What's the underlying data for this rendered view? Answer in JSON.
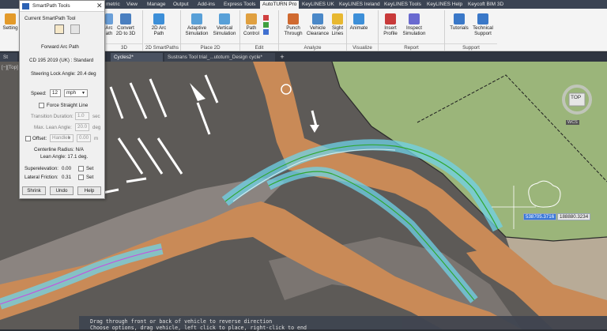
{
  "ribbon": {
    "tabs": [
      "St",
      "metric",
      "View",
      "Manage",
      "Output",
      "Add-ins",
      "Express Tools",
      "AutoTURN Pro",
      "KeyLINES UK",
      "KeyLINES Ireland",
      "KeyLINES Tools",
      "KeyLINES Help",
      "Keycoft BIM 3D"
    ],
    "active_tab": "AutoTURN Pro",
    "buttons": {
      "setting": "Setting",
      "arc_path": [
        "Arc",
        "ath"
      ],
      "convert": [
        "Convert",
        "2D to 3D"
      ],
      "arc2d": [
        "2D Arc",
        "Path"
      ],
      "adaptive": [
        "Adaptive",
        "Simulation"
      ],
      "vertical": [
        "Vertical",
        "Simulation"
      ],
      "path_control": [
        "Path",
        "Control"
      ],
      "punch": [
        "Punch",
        "Through"
      ],
      "vehicle_clear": [
        "Vehicle",
        "Clearance"
      ],
      "sight": [
        "Sight",
        "Lines"
      ],
      "animate": "Animate",
      "insert_profile": [
        "Insert",
        "Profile"
      ],
      "inspect": [
        "Inspect",
        "Simulation"
      ],
      "tutorials": "Tutorials",
      "tech_support": [
        "Technical",
        "Support"
      ]
    },
    "groups": [
      "3D",
      "2D SmartPaths",
      "Place 2D",
      "Edit",
      "Analyze",
      "Visualize",
      "Report",
      "Support"
    ]
  },
  "doc_tabs": [
    "St",
    "Cycles2*",
    "Sustrans Tool trial_...utoturn_Design cycle*"
  ],
  "viewport_label": "[−][Top]",
  "panel": {
    "title": "SmartPath Tools",
    "current_tool_label": "Current SmartPath Tool",
    "path_type": "Forward Arc Path",
    "vehicle": "CD 195 2019 (UK) : Standard",
    "steering": "Steering Lock Angle: 20.4 deg",
    "speed_label": "Speed:",
    "speed_value": "12",
    "speed_unit": "mph",
    "force_straight": "Force Straight Line",
    "transition_label": "Transition Duration:",
    "transition_value": "1.0",
    "transition_unit": "sec",
    "lean_label": "Max. Lean Angle:",
    "lean_value": "20.0",
    "lean_unit": "deg",
    "offset_label": "Offset:",
    "offset_select": "Handleb",
    "offset_value": "0.00",
    "offset_unit": "m",
    "centerline": "Centerline Radius: N/A",
    "lean_angle": "Lean Angle: 17.1 deg.",
    "superelev_label": "Superelevation:",
    "superelev_value": "0.00",
    "lateral_label": "Lateral Friction:",
    "lateral_value": "0.31",
    "set_label": "Set",
    "shrink": "Shrink",
    "undo": "Undo",
    "help": "Help"
  },
  "viewcube": {
    "top_label": "TOP",
    "wcs_label": "WCS"
  },
  "cursor_coords": {
    "x": "538705.3716",
    "y": "188880.3234"
  },
  "command_line": {
    "line1": "Drag through front or back of vehicle to reverse direction",
    "line2": "Choose options, drag vehicle, left click to place, right-click to end"
  }
}
